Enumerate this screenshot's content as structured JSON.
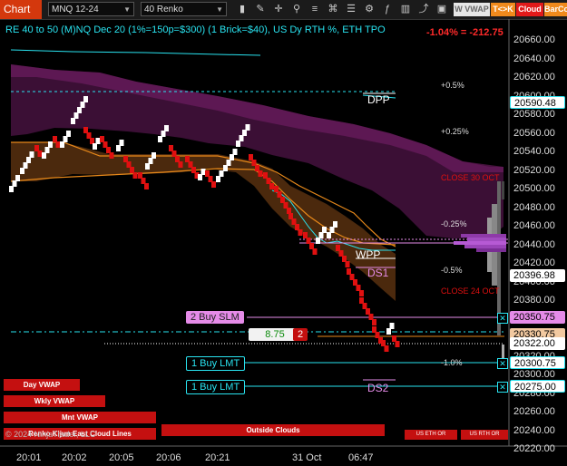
{
  "toolbar": {
    "brand": "Chart",
    "instrument": "MNQ 12-24",
    "bar_type": "40 Renko",
    "tags": {
      "w_vwap": "W VWAP",
      "tk": "T<>K",
      "cloud": "Cloud",
      "barco": "BarCo"
    }
  },
  "header": {
    "title": "RE 40 to 50 (M)NQ Dec 20 (1%=150p=$300) (1 Brick=$40), US Dy RTH %, ETH TPO",
    "pnl": "-1.04% = -212.75"
  },
  "levels": {
    "p05": "+0.5%",
    "p025": "+0.25%",
    "close30": "CLOSE 30 OCT",
    "m025": "-0.25%",
    "m05": "-0.5%",
    "close24": "CLOSE 24 OCT",
    "m10": "-1.0%",
    "dpp": "DPP",
    "wpp": "WPP",
    "ds1": "DS1",
    "ds2": "DS2"
  },
  "orders": {
    "buy_slm": {
      "label": "2 Buy SLM",
      "price": "20350.75"
    },
    "position": {
      "pnl_points": "8.75",
      "qty": "2"
    },
    "buy_lmt1": {
      "label": "1 Buy LMT",
      "price": "20300.75"
    },
    "buy_lmt2": {
      "label": "1 Buy LMT",
      "price": "20275.00"
    }
  },
  "price_tags": {
    "dpp": "20590.48",
    "wpp": "20396.98",
    "ask": "20330.75",
    "last": "20322.00"
  },
  "y_axis": [
    "20660.00",
    "20640.00",
    "20620.00",
    "20600.00",
    "20580.00",
    "20560.00",
    "20540.00",
    "20520.00",
    "20500.00",
    "20480.00",
    "20460.00",
    "20440.00",
    "20420.00",
    "20400.00",
    "20380.00",
    "20360.00",
    "20340.00",
    "20320.00",
    "20300.00",
    "20280.00",
    "20260.00",
    "20240.00",
    "20220.00"
  ],
  "x_axis": [
    "20:01",
    "20:02",
    "20:05",
    "20:06",
    "20:21",
    "31 Oct",
    "06:47"
  ],
  "bottom_labels": {
    "day_vwap": "Day VWAP",
    "wkly_vwap": "Wkly VWAP",
    "mnt_vwap": "Mnt VWAP",
    "ichimoku": "Renko Kijun East Cloud Lines",
    "outside_clouds": "Outside Clouds",
    "us_eth_or": "US ETH OR",
    "us_rth_or": "US RTH OR",
    "copyright": "© 2024 NinjaTrader, LLC"
  },
  "colors": {
    "bull": "#ffffff",
    "bear": "#e01010",
    "cyan": "#29e3f0",
    "cloud": "#5a1850",
    "orange": "#e8891a",
    "order_pink": "#e58be8"
  }
}
